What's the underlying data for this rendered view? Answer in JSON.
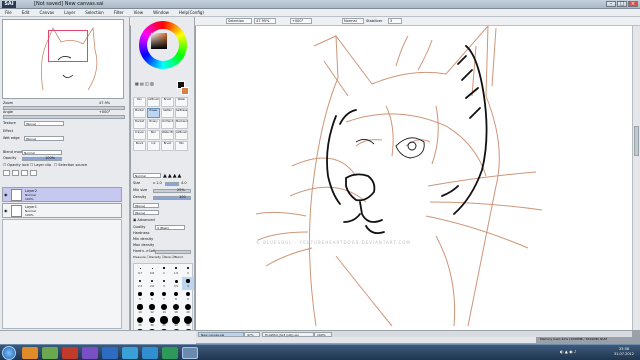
{
  "window": {
    "title": "[Not saved] New canvas.sai",
    "logo": "SAI",
    "btn_min": "–",
    "btn_max": "□",
    "btn_close": "×"
  },
  "menu": [
    "File",
    "Edit",
    "Canvas",
    "Layer",
    "Selection",
    "Filter",
    "View",
    "Window",
    "Help(Config)"
  ],
  "toolbar": {
    "selection_label": "Selection",
    "zoom": "47.95%",
    "angle": "+000°",
    "blend": "Normal",
    "stabilizer_label": "Stabilizer",
    "stabilizer": "3"
  },
  "navigator": {
    "zoom_label": "Zoom",
    "zoom_value": "47.9%",
    "angle_label": "Angle",
    "angle_value": "+000°"
  },
  "texture": {
    "label": "Texture",
    "value": "[None]",
    "effect_label": "Effect",
    "edge_label": "Wet edge",
    "edge_value": "[None]"
  },
  "blend": {
    "label": "Blend mode",
    "value": "Normal",
    "opacity_label": "Opacity",
    "opacity_value": "100%",
    "preserve_opacity": "Opacity lock",
    "clip": "Layer clip",
    "sel_source": "Selection source"
  },
  "layers": [
    {
      "name": "Layer2",
      "mode": "Normal",
      "opacity": "100%"
    },
    {
      "name": "Layer1",
      "mode": "Normal",
      "opacity": "100%"
    }
  ],
  "tools": [
    "Pen",
    "AirBrush",
    "Brush",
    "Water",
    "Marker",
    "Eraser",
    "SelPen",
    "SelErase",
    "Bucket",
    "Binary",
    "Oil Paint",
    "Mechanic",
    "Crayon",
    "Blur",
    "Water Bl",
    "AirBrush",
    "Pencil",
    "Ink",
    "Brush",
    "Mix"
  ],
  "brush": {
    "mode": "Normal",
    "size_label": "Size",
    "size_mult": "x 1.0",
    "size_value": "4.0",
    "min_size_label": "Min size",
    "min_size_value": "25%",
    "density_label": "Density",
    "density_value": "100",
    "shape": "[None]",
    "texture": "[None]",
    "advanced": "Advanced",
    "quality_label": "Quality",
    "quality_value": "4 (Best)",
    "hardness_label": "Hardness",
    "min_density": "Min density",
    "max_density": "Max density",
    "hard_soft": "Hard<->Soft",
    "pressure": "Pressure",
    "density_chk": "Density",
    "size_chk": "Size",
    "blend_chk": "Blend"
  },
  "brush_sizes": [
    "0.7",
    "0.8",
    "1",
    "1.5",
    "2",
    "2.3",
    "2.6",
    "3",
    "3.5",
    "4",
    "5",
    "6",
    "7",
    "8",
    "9",
    "10",
    "12",
    "14",
    "16",
    "20",
    "25",
    "30",
    "35",
    "40",
    "50",
    "60",
    "70",
    "80",
    "100",
    "120"
  ],
  "tabs": [
    {
      "name": "New canvas.sai",
      "zoom": "47%"
    },
    {
      "name": "fir-AWSd (3x3 (L6)).sai",
      "zoom": "100%"
    }
  ],
  "status": {
    "memory": "Memory load: 40% (1598MB / 7849MB)",
    "caps": "NUM"
  },
  "clock": {
    "time": "23:58",
    "date": "31.07.2012"
  },
  "watermark": "© BLUESOUL - YOUTUBEHEARTDOGS.DEVIANTART.COM",
  "colors": {
    "sketch": "#c98a6a",
    "lines": "#111111",
    "fg": "#111111",
    "bg": "#d77f47"
  }
}
